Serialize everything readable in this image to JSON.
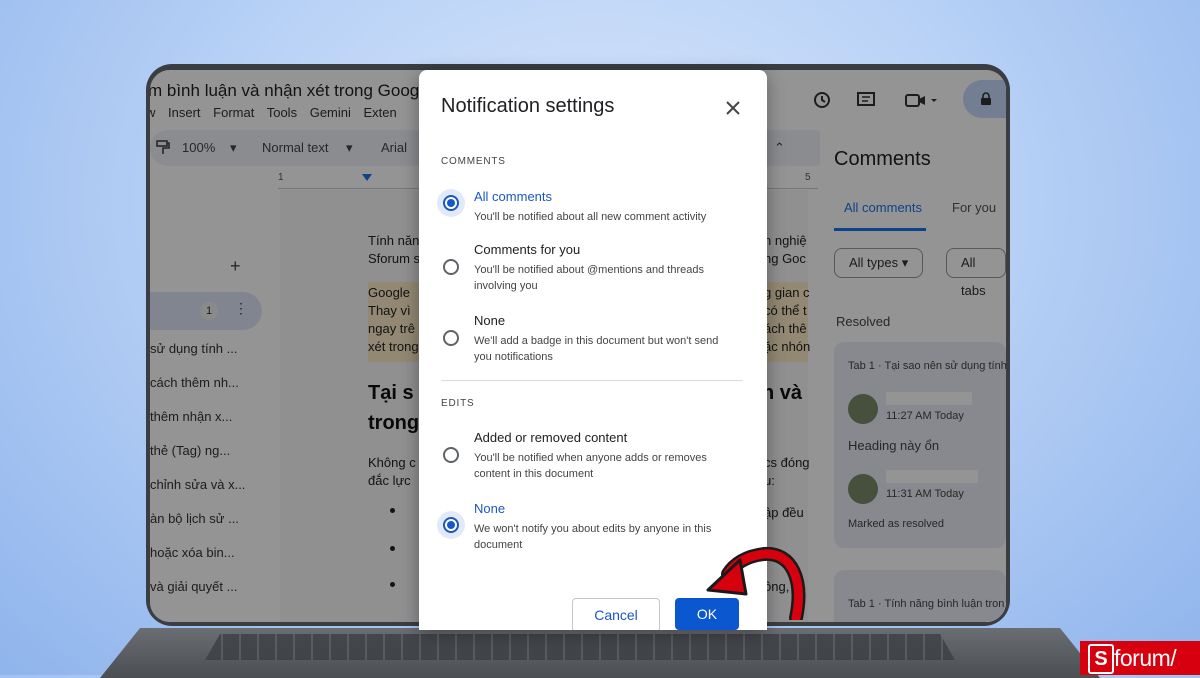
{
  "document": {
    "title": "m bình luận và nhận xét trong Google",
    "menu": [
      "w",
      "Insert",
      "Format",
      "Tools",
      "Gemini",
      "Exten"
    ],
    "toolbar": {
      "zoom": "100%",
      "style": "Normal text",
      "font": "Arial"
    },
    "ruler": {
      "left_mark": "1",
      "right_mark": "5"
    },
    "outline_badge": "1",
    "outline_items": [
      "sử dụng tính ...",
      "cách thêm nh...",
      "thêm nhận x...",
      "thẻ (Tag) ng...",
      "chỉnh sửa và x...",
      "àn bộ lịch sử ...",
      "hoặc xóa bin...",
      "và giải quyết ..."
    ],
    "body": {
      "p1_line1": "Tính năn",
      "p1_line2": "Sforum s",
      "p1_right1": "n nghiệ",
      "p1_right2": "ng Goc",
      "hl_line1": "Google",
      "hl_line2": "Thay vì",
      "hl_line3": "ngay trê",
      "hl_line4": "xét trong",
      "hl_right1": "g gian c",
      "hl_right2": "có thể t",
      "hl_right3": "ách thê",
      "hl_right4": "ặc nhón",
      "heading_line1": "Tại s",
      "heading_line2": "trong",
      "heading_right": "n và",
      "p2_line1": "Không c",
      "p2_line2": "đắc lực",
      "p2_right1": "cs đóng",
      "p2_right2": "u:",
      "bullet_right1": "ập đều",
      "bullet_right2": "ông, gi"
    }
  },
  "comments_panel": {
    "title": "Comments",
    "tabs": [
      "All comments",
      "For you"
    ],
    "filters": [
      "All types",
      "All tabs"
    ],
    "resolved_label": "Resolved",
    "thread1": {
      "context": "Tab 1 · Tại sao nên sử dụng tính",
      "reply1_time": "11:27 AM Today",
      "reply1_text": "Heading này ổn",
      "reply2_time": "11:31 AM Today",
      "reply2_text": "Marked as resolved"
    },
    "thread2": {
      "context": "Tab 1 · Tính năng bình luận tron"
    }
  },
  "dialog": {
    "title": "Notification settings",
    "comments_section": "COMMENTS",
    "comment_options": [
      {
        "label": "All comments",
        "desc": "You'll be notified about all new comment activity"
      },
      {
        "label": "Comments for you",
        "desc": "You'll be notified about @mentions and threads involving you"
      },
      {
        "label": "None",
        "desc": "We'll add a badge in this document but won't send you notifications"
      }
    ],
    "edits_section": "EDITS",
    "edit_options": [
      {
        "label": "Added or removed content",
        "desc": "You'll be notified when anyone adds or removes content in this document"
      },
      {
        "label": "None",
        "desc": "We won't notify you about edits by anyone in this document"
      }
    ],
    "cancel_label": "Cancel",
    "ok_label": "OK"
  },
  "colors": {
    "accent": "#0b57d0",
    "arrow": "#d7000f",
    "logo_bg": "#d7000f"
  },
  "logo": {
    "mark": "S",
    "text": "forum/"
  }
}
